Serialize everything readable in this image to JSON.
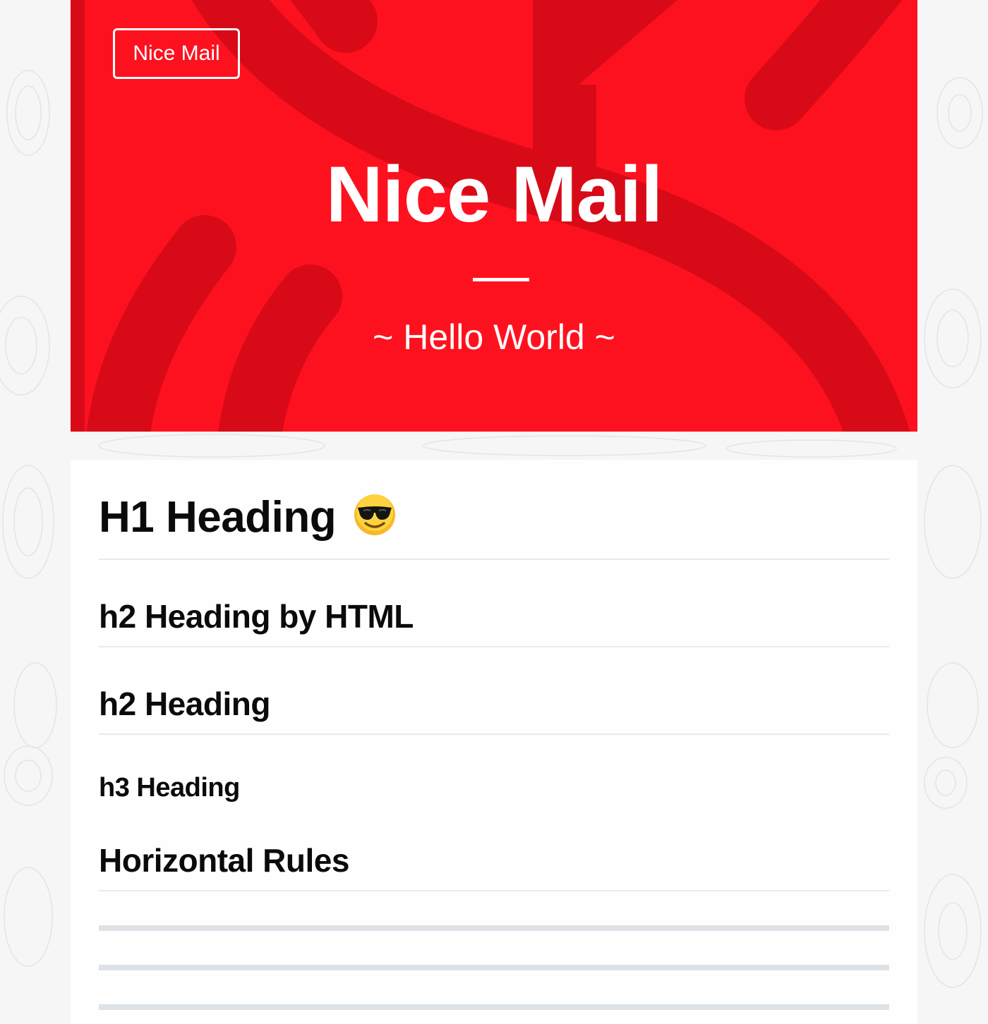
{
  "colors": {
    "hero_background": "#fe111f",
    "hero_shapes": "#d80a18",
    "text_light": "#ffffff",
    "text_dark": "#0b0b0b",
    "heading_rule": "#e9eaec",
    "horizontal_rule": "#dde2e7",
    "page_background": "#f6f6f6"
  },
  "hero": {
    "brand_label": "Nice Mail",
    "title": "Nice Mail",
    "subtitle": "~ Hello World ~"
  },
  "content": {
    "h1": "H1 Heading",
    "h1_emoji_icon": "smiling-face-with-sunglasses-icon",
    "h2_html": "h2 Heading by HTML",
    "h2": "h2 Heading",
    "h3": "h3 Heading",
    "section_title": "Horizontal Rules"
  }
}
